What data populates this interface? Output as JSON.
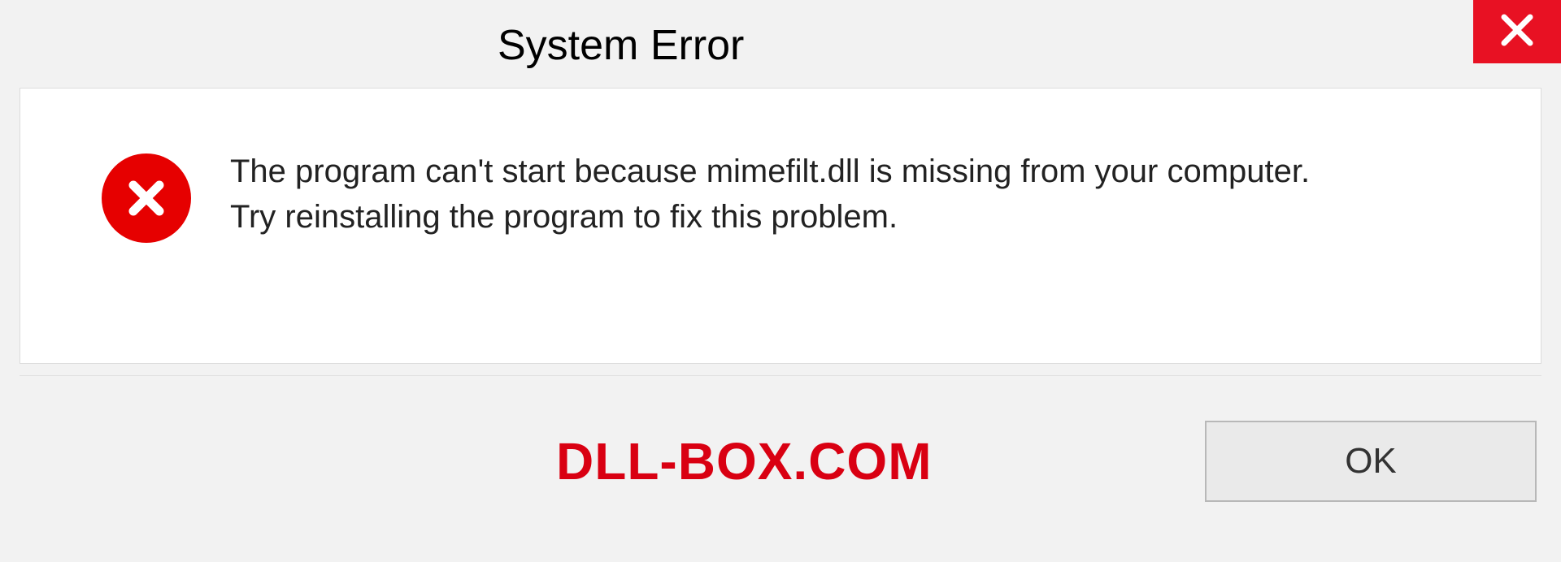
{
  "titlebar": {
    "title": "System Error"
  },
  "dialog": {
    "message_line1": "The program can't start because mimefilt.dll is missing from your computer.",
    "message_line2": "Try reinstalling the program to fix this problem."
  },
  "footer": {
    "brand": "DLL-BOX.COM",
    "ok_label": "OK"
  }
}
